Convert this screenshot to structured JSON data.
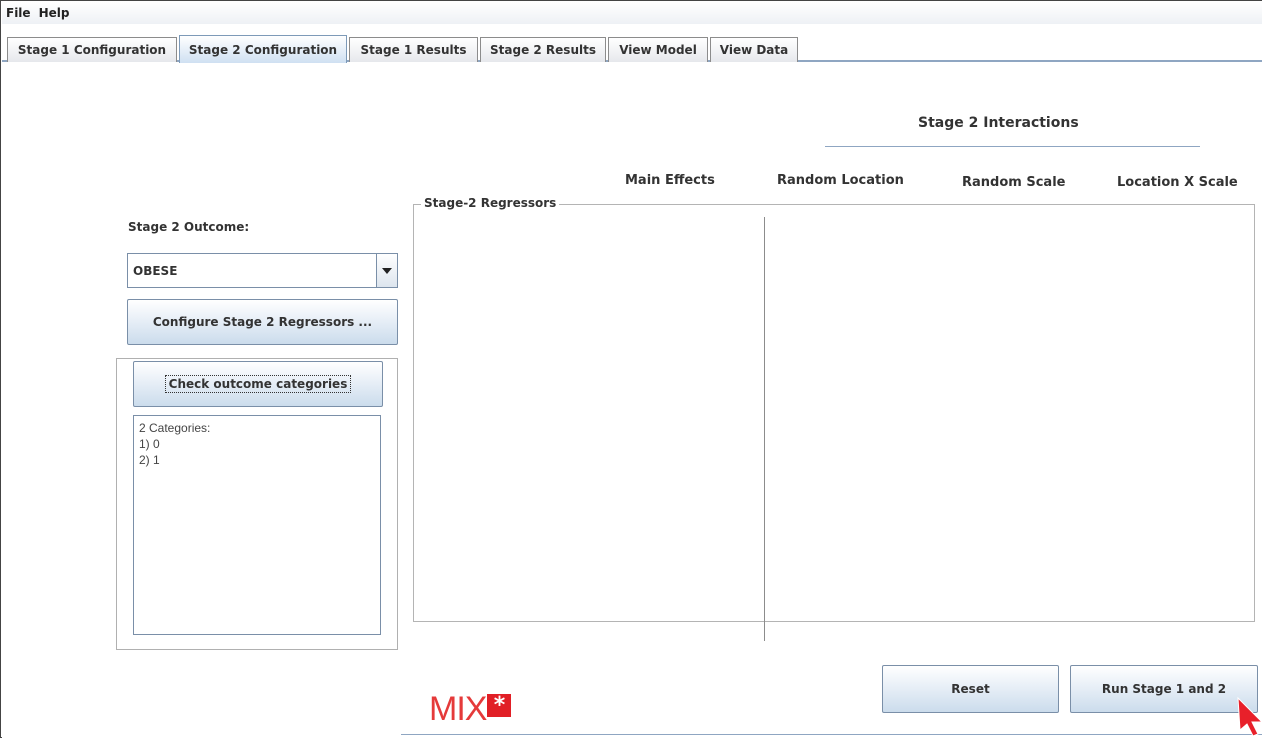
{
  "menubar": {
    "items": [
      {
        "label": "File"
      },
      {
        "label": "Help"
      }
    ]
  },
  "tabs": [
    {
      "label": "Stage 1 Configuration"
    },
    {
      "label": "Stage 2 Configuration",
      "active": true
    },
    {
      "label": "Stage 1 Results"
    },
    {
      "label": "Stage 2 Results"
    },
    {
      "label": "View Model"
    },
    {
      "label": "View Data"
    }
  ],
  "interactions": {
    "title": "Stage 2 Interactions"
  },
  "columns": {
    "main_effects": "Main Effects",
    "random_location": "Random Location",
    "random_scale": "Random Scale",
    "location_x_scale": "Location X Scale"
  },
  "outcome": {
    "label": "Stage 2 Outcome:",
    "selected": "OBESE"
  },
  "buttons": {
    "configure_regressors": "Configure Stage 2 Regressors ...",
    "check_categories": "Check outcome categories",
    "reset": "Reset",
    "run": "Run Stage 1 and 2"
  },
  "categories": {
    "lines": [
      "2 Categories:",
      "1) 0",
      "2) 1"
    ]
  },
  "regressors": {
    "title": "Stage-2 Regressors"
  },
  "logo": {
    "text": "MIX",
    "star": "*"
  },
  "colors": {
    "accent": "#8fa6c2",
    "logo_red": "#e11f26",
    "cursor_red": "#e8202a"
  }
}
